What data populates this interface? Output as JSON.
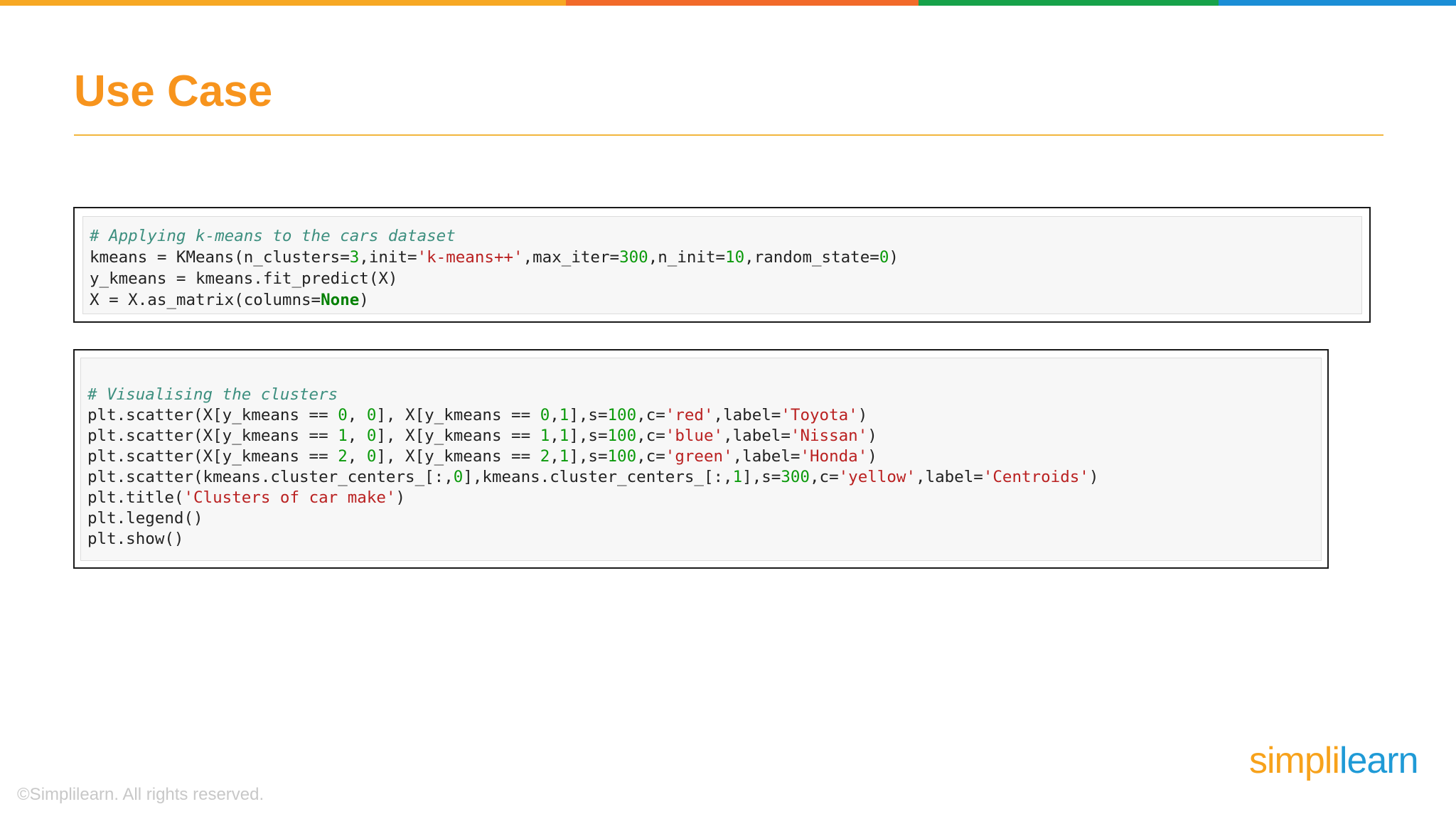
{
  "topbar": {
    "segments": [
      {
        "color": "#f7a823"
      },
      {
        "color": "#f26a2a"
      },
      {
        "color": "#17a24a"
      },
      {
        "color": "#1b8ed6"
      }
    ]
  },
  "slide": {
    "title": "Use Case"
  },
  "cell1": {
    "lines": [
      [
        {
          "t": "# Applying k-means to the cars dataset",
          "c": "cm"
        }
      ],
      [
        {
          "t": "kmeans = KMeans(n_clusters="
        },
        {
          "t": "3",
          "c": "n"
        },
        {
          "t": ",init="
        },
        {
          "t": "'k-means++'",
          "c": "s"
        },
        {
          "t": ",max_iter="
        },
        {
          "t": "300",
          "c": "n"
        },
        {
          "t": ",n_init="
        },
        {
          "t": "10",
          "c": "n"
        },
        {
          "t": ",random_state="
        },
        {
          "t": "0",
          "c": "n"
        },
        {
          "t": ")"
        }
      ],
      [
        {
          "t": "y_kmeans = kmeans.fit_predict(X)"
        }
      ],
      [
        {
          "t": "X = X.as_matrix(columns="
        },
        {
          "t": "None",
          "c": "k"
        },
        {
          "t": ")"
        }
      ]
    ]
  },
  "cell2": {
    "lines": [
      [
        {
          "t": "# Visualising the clusters",
          "c": "cm"
        }
      ],
      [
        {
          "t": "plt.scatter(X[y_kmeans == "
        },
        {
          "t": "0",
          "c": "n"
        },
        {
          "t": ", "
        },
        {
          "t": "0",
          "c": "n"
        },
        {
          "t": "], X[y_kmeans == "
        },
        {
          "t": "0",
          "c": "n"
        },
        {
          "t": ","
        },
        {
          "t": "1",
          "c": "n"
        },
        {
          "t": "],s="
        },
        {
          "t": "100",
          "c": "n"
        },
        {
          "t": ",c="
        },
        {
          "t": "'red'",
          "c": "s"
        },
        {
          "t": ",label="
        },
        {
          "t": "'Toyota'",
          "c": "s"
        },
        {
          "t": ")"
        }
      ],
      [
        {
          "t": "plt.scatter(X[y_kmeans == "
        },
        {
          "t": "1",
          "c": "n"
        },
        {
          "t": ", "
        },
        {
          "t": "0",
          "c": "n"
        },
        {
          "t": "], X[y_kmeans == "
        },
        {
          "t": "1",
          "c": "n"
        },
        {
          "t": ","
        },
        {
          "t": "1",
          "c": "n"
        },
        {
          "t": "],s="
        },
        {
          "t": "100",
          "c": "n"
        },
        {
          "t": ",c="
        },
        {
          "t": "'blue'",
          "c": "s"
        },
        {
          "t": ",label="
        },
        {
          "t": "'Nissan'",
          "c": "s"
        },
        {
          "t": ")"
        }
      ],
      [
        {
          "t": "plt.scatter(X[y_kmeans == "
        },
        {
          "t": "2",
          "c": "n"
        },
        {
          "t": ", "
        },
        {
          "t": "0",
          "c": "n"
        },
        {
          "t": "], X[y_kmeans == "
        },
        {
          "t": "2",
          "c": "n"
        },
        {
          "t": ","
        },
        {
          "t": "1",
          "c": "n"
        },
        {
          "t": "],s="
        },
        {
          "t": "100",
          "c": "n"
        },
        {
          "t": ",c="
        },
        {
          "t": "'green'",
          "c": "s"
        },
        {
          "t": ",label="
        },
        {
          "t": "'Honda'",
          "c": "s"
        },
        {
          "t": ")"
        }
      ],
      [
        {
          "t": "plt.scatter(kmeans.cluster_centers_[:,"
        },
        {
          "t": "0",
          "c": "n"
        },
        {
          "t": "],kmeans.cluster_centers_[:,"
        },
        {
          "t": "1",
          "c": "n"
        },
        {
          "t": "],s="
        },
        {
          "t": "300",
          "c": "n"
        },
        {
          "t": ",c="
        },
        {
          "t": "'yellow'",
          "c": "s"
        },
        {
          "t": ",label="
        },
        {
          "t": "'Centroids'",
          "c": "s"
        },
        {
          "t": ")"
        }
      ],
      [
        {
          "t": "plt.title("
        },
        {
          "t": "'Clusters of car make'",
          "c": "s"
        },
        {
          "t": ")"
        }
      ],
      [
        {
          "t": "plt.legend()"
        }
      ],
      [
        {
          "t": "plt.show()"
        }
      ]
    ]
  },
  "footer": {
    "copyright": "©Simplilearn. All rights reserved.",
    "logo_part1": "simpl",
    "logo_part2": "i",
    "logo_part3": "learn"
  },
  "colors": {
    "title": "#f7941d",
    "comment": "#3d8f7f",
    "string": "#ba2121",
    "number": "#0b9a0b"
  }
}
